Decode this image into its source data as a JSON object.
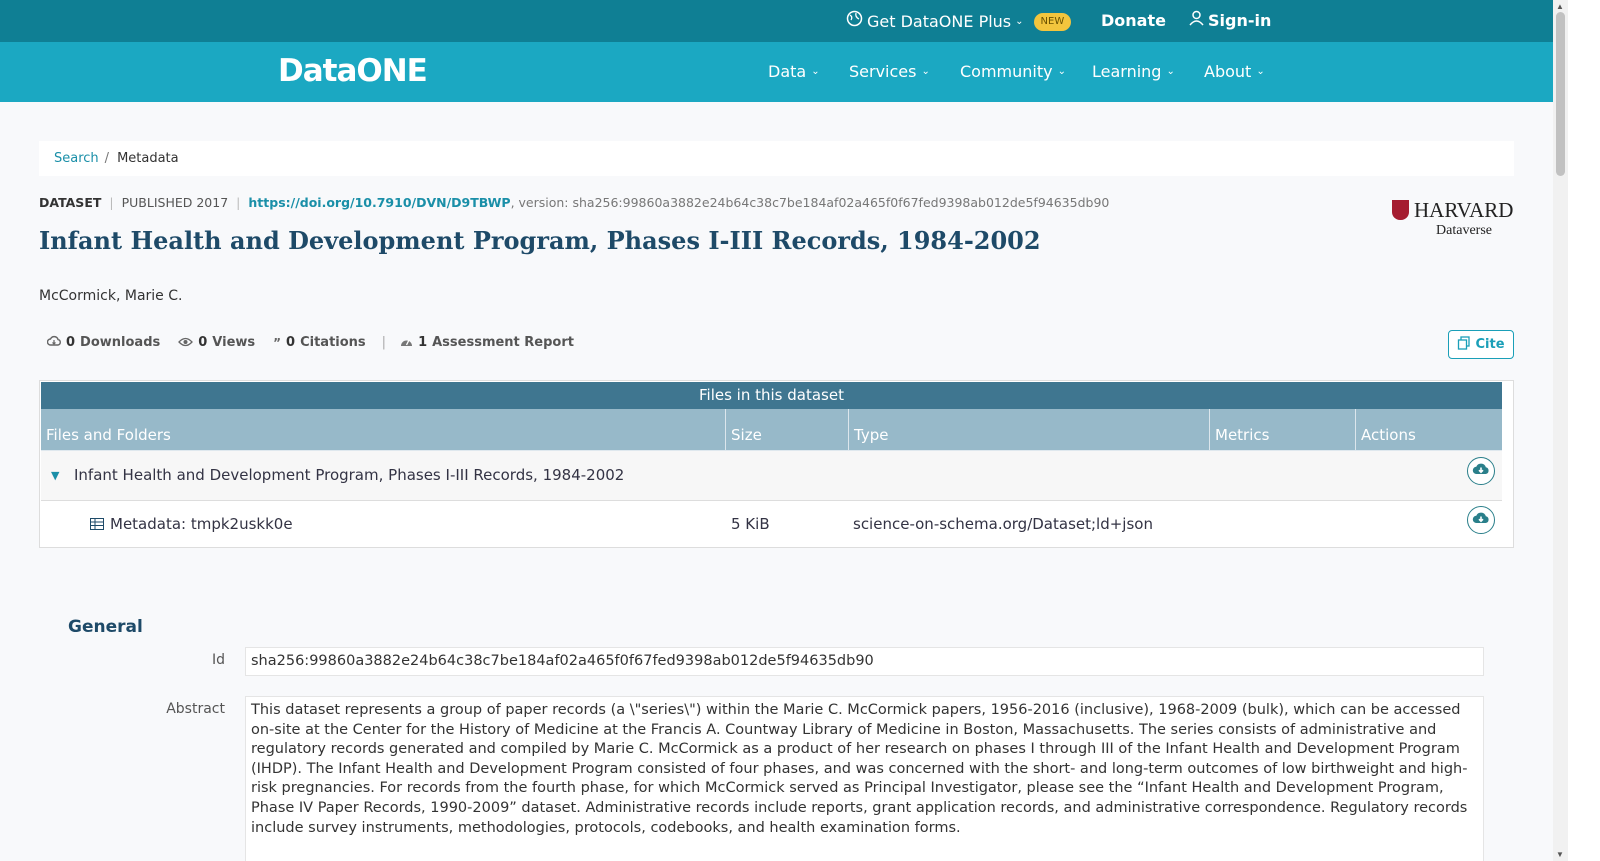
{
  "topbar": {
    "plus_label": "Get DataONE Plus",
    "new_badge": "NEW",
    "donate_label": "Donate",
    "signin_label": "Sign-in"
  },
  "navbar": {
    "logo_text": "DataONE",
    "items": [
      {
        "label": "Data"
      },
      {
        "label": "Services"
      },
      {
        "label": "Community"
      },
      {
        "label": "Learning"
      },
      {
        "label": "About"
      }
    ]
  },
  "breadcrumb": {
    "search_label": "Search",
    "separator": "/",
    "current": "Metadata"
  },
  "dataset": {
    "type_label": "DATASET",
    "published": "PUBLISHED 2017",
    "doi": "https://doi.org/10.7910/DVN/D9TBWP",
    "version": ", version: sha256:99860a3882e24b64c38c7be184af02a465f0f67fed9398ab012de5f94635db90",
    "title": "Infant Health and Development Program, Phases I-III Records, 1984-2002",
    "author": "McCormick, Marie C.",
    "repository": {
      "name": "HARVARD",
      "sub": "Dataverse"
    }
  },
  "metrics": {
    "downloads": {
      "count": "0",
      "label": "Downloads"
    },
    "views": {
      "count": "0",
      "label": "Views"
    },
    "citations": {
      "count": "0",
      "label": "Citations"
    },
    "assessment": {
      "count": "1",
      "label": "Assessment Report"
    }
  },
  "cite_label": "Cite",
  "files": {
    "header": "Files in this dataset",
    "columns": [
      "Files and Folders",
      "Size",
      "Type",
      "Metrics",
      "Actions"
    ],
    "rows": [
      {
        "name": "Infant Health and Development Program, Phases I-III Records, 1984-2002",
        "size": "",
        "type": ""
      },
      {
        "name": "Metadata: tmpk2uskk0e",
        "size": "5 KiB",
        "type": "science-on-schema.org/Dataset;ld+json"
      }
    ]
  },
  "general": {
    "title": "General",
    "id_label": "Id",
    "id_value": "sha256:99860a3882e24b64c38c7be184af02a465f0f67fed9398ab012de5f94635db90",
    "abstract_label": "Abstract",
    "abstract_value": "This dataset represents a group of paper records (a \\\"series\\\") within the Marie C. McCormick papers, 1956-2016 (inclusive), 1968-2009 (bulk), which can be accessed on-site at the Center for the History of Medicine at the Francis A. Countway Library of Medicine in Boston, Massachusetts. The series consists of administrative and regulatory records generated and compiled by Marie C. McCormick as a product of her research on phases I through III of the Infant Health and Development Program (IHDP). The Infant Health and Development Program consisted of four phases, and was concerned with the short- and long-term outcomes of low birthweight and high-risk pregnancies. For records from the fourth phase, for which McCormick served as Principal Investigator, please see the “Infant Health and Development Program, Phase IV Paper Records, 1990-2009” dataset. Administrative records include reports, grant application records, and administrative correspondence. Regulatory records include survey instruments, methodologies, protocols, codebooks, and health examination forms."
  },
  "colors": {
    "topbar": "#0f7f94",
    "navbar": "#1ba8c2",
    "files_header": "#3f7690",
    "files_cols": "#97b9c9",
    "title": "#1e4a68",
    "link": "#1a8fa8"
  }
}
